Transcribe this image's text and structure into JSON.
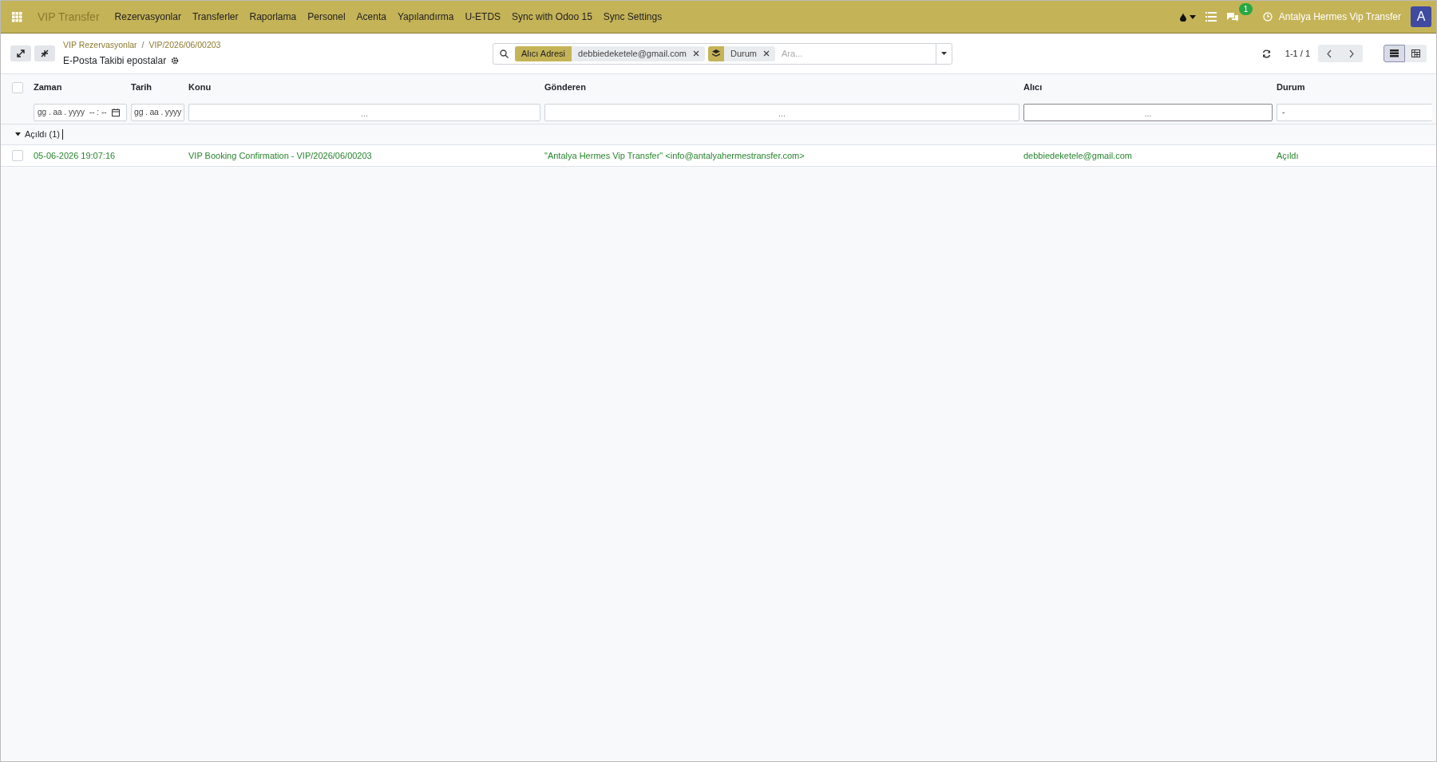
{
  "navbar": {
    "app_name": "VIP Transfer",
    "menu": [
      "Rezervasyonlar",
      "Transferler",
      "Raporlama",
      "Personel",
      "Acenta",
      "Yapılandırma",
      "U-ETDS",
      "Sync with Odoo 15",
      "Sync Settings"
    ],
    "message_count": "1",
    "company": "Antalya Hermes Vip Transfer",
    "avatar": "A"
  },
  "control_panel": {
    "breadcrumbs": [
      "VIP Rezervasyonlar",
      "VIP/2026/06/00203"
    ],
    "breadcrumb_separator": "/",
    "title": "E-Posta Takibi epostalar",
    "facets": [
      {
        "kind": "filter",
        "label": "Alıcı Adresi",
        "value": "debbiedeketele@gmail.com"
      },
      {
        "kind": "group",
        "value": "Durum"
      }
    ],
    "search_placeholder": "Ara...",
    "pager": "1-1 / 1",
    "views": [
      {
        "kind": "list",
        "selected": true
      },
      {
        "kind": "pivot",
        "selected": false
      }
    ]
  },
  "table": {
    "all_checked": false,
    "columns": [
      {
        "label": "Zaman",
        "filter": {
          "kind": "datetime",
          "date": "gg . aa . yyyy",
          "time": "-- : --"
        }
      },
      {
        "label": "Tarih",
        "filter": {
          "kind": "date",
          "date": "gg . aa . yyyy"
        }
      },
      {
        "label": "Konu",
        "filter": {
          "kind": "text",
          "placeholder": "...",
          "focused": false
        }
      },
      {
        "label": "Gönderen",
        "filter": {
          "kind": "text",
          "placeholder": "...",
          "focused": false
        }
      },
      {
        "label": "Alıcı",
        "filter": {
          "kind": "text",
          "placeholder": "...",
          "focused": true
        }
      },
      {
        "label": "Durum",
        "filter": {
          "kind": "select",
          "value": "-"
        }
      }
    ],
    "groups": [
      {
        "label": "Açıldı (1)",
        "expanded": true,
        "rows": [
          {
            "checked": false,
            "cells": [
              "05-06-2026 19:07:16",
              "",
              "VIP Booking Confirmation - VIP/2026/06/00203",
              "\"Antalya Hermes Vip Transfer\" <info@antalyahermestransfer.com>",
              "debbiedeketele@gmail.com",
              "Açıldı"
            ]
          }
        ]
      }
    ]
  }
}
